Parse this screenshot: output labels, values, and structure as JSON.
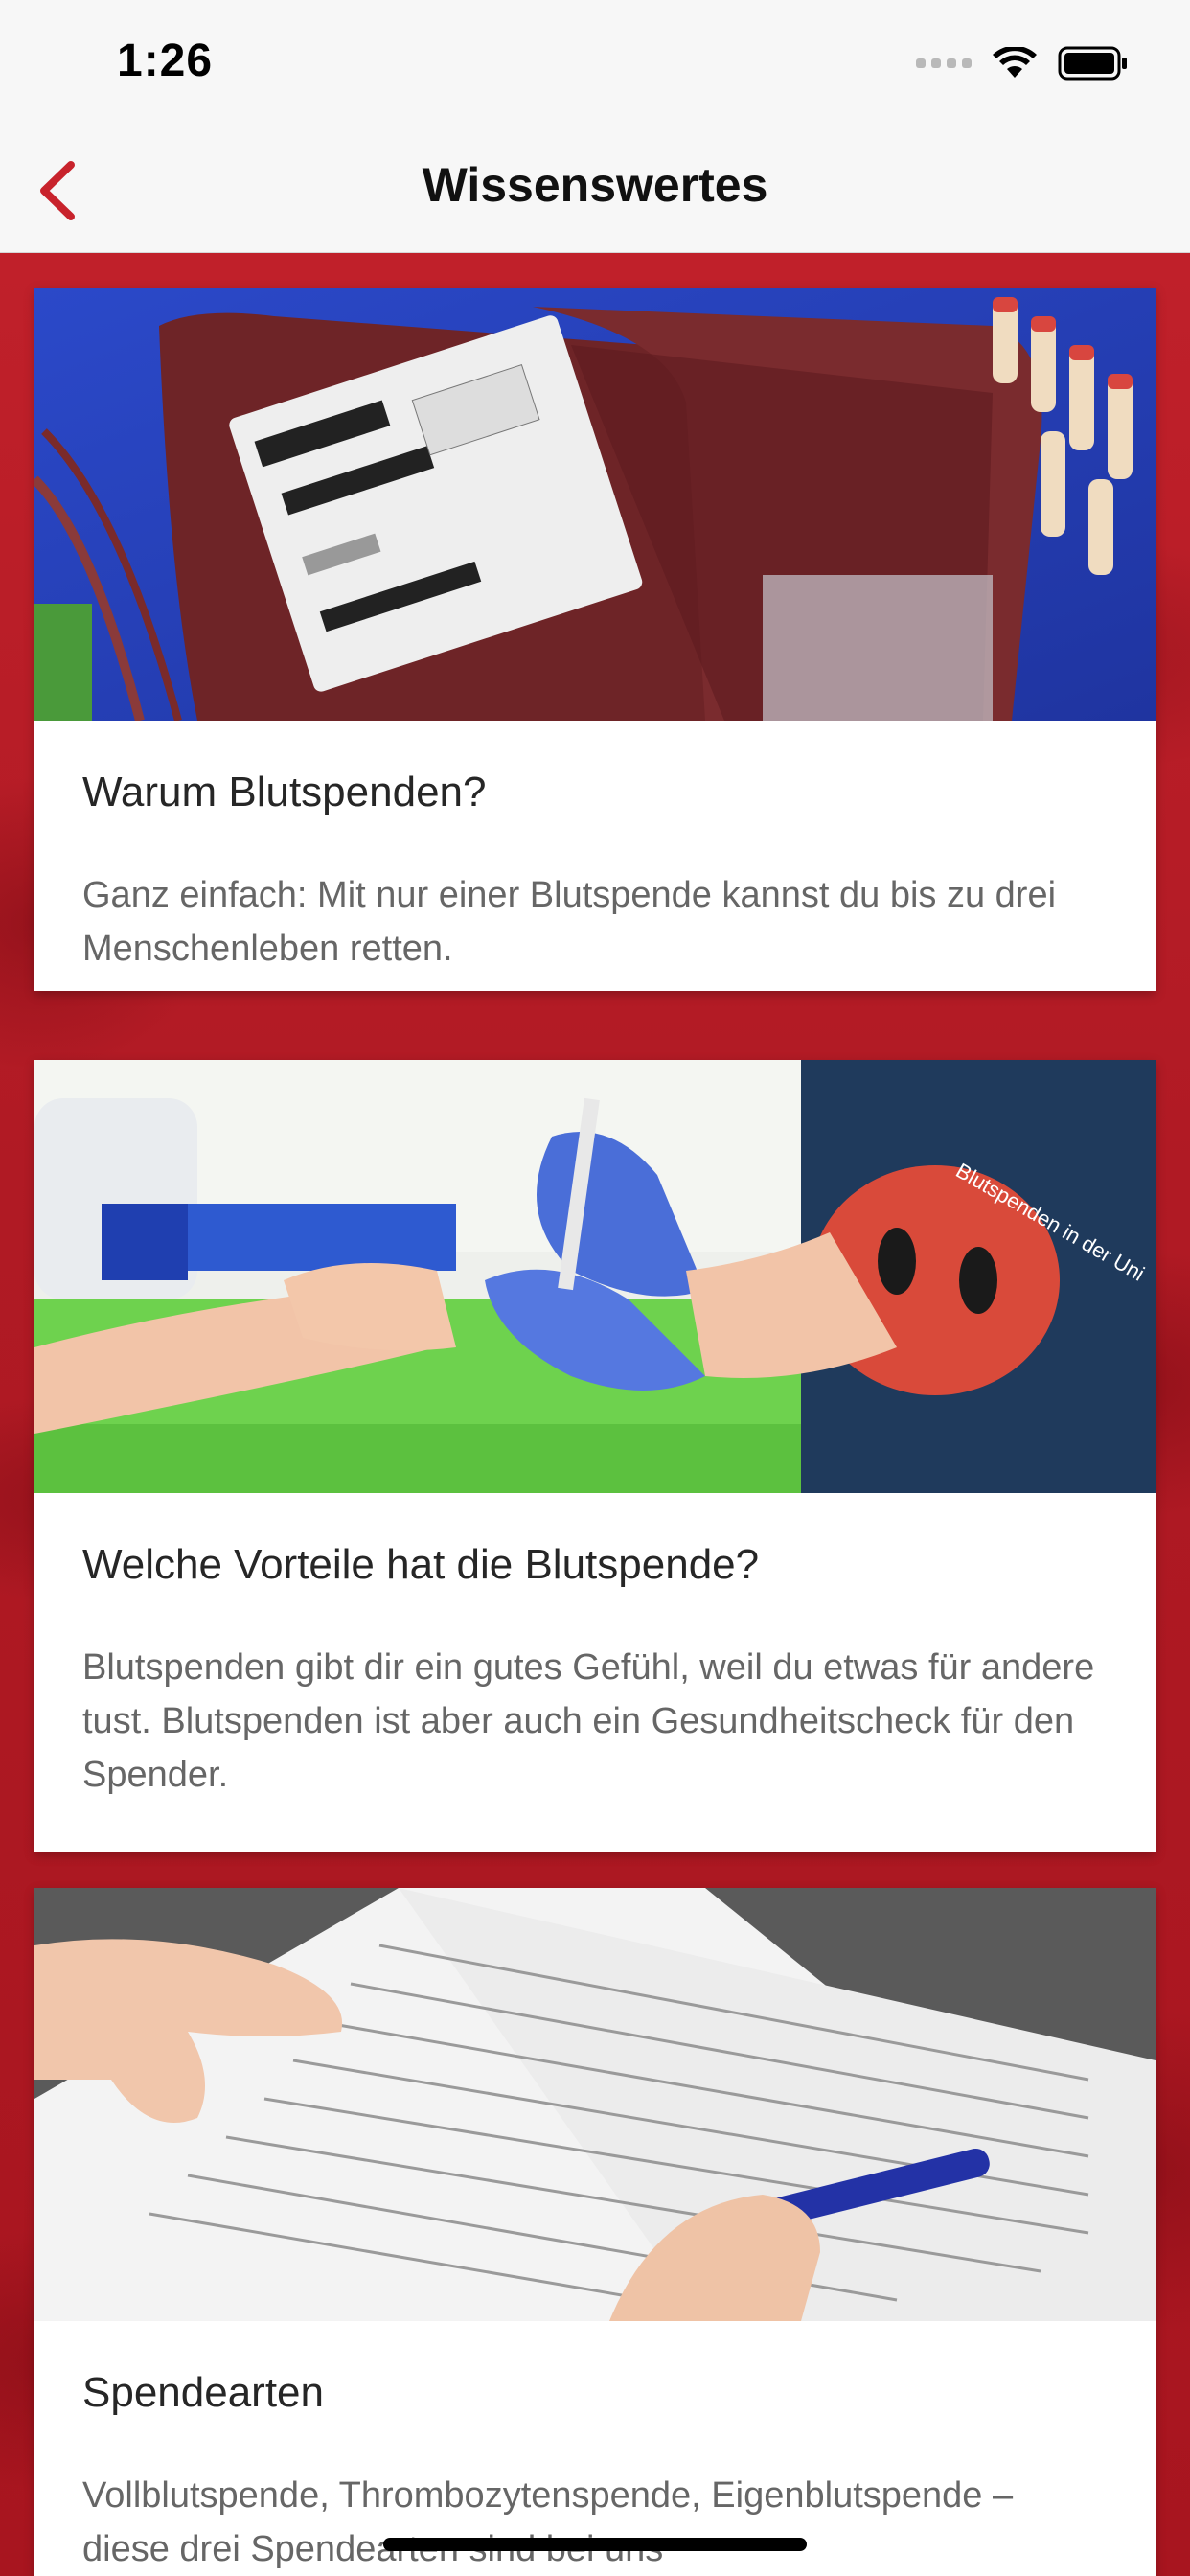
{
  "status_bar": {
    "time": "1:26"
  },
  "nav": {
    "title": "Wissenswertes",
    "back_label": "Zurück"
  },
  "colors": {
    "accent": "#c8232c",
    "background_red": "#b01a24"
  },
  "cards": [
    {
      "title": "Warum Blutspenden?",
      "text": "Ganz einfach: Mit nur einer Blutspende kannst du bis zu drei Menschenleben retten.",
      "image_description": "blood-bags-photo"
    },
    {
      "title": "Welche Vorteile hat die Blutspende?",
      "text": "Blutspenden gibt dir ein gutes Gefühl, weil du etwas für andere tust. Blutspenden ist aber auch ein Gesundheitscheck für den Spender.",
      "image_description": "finger-prick-test-photo",
      "shirt_text": "Blutspenden in der Uni"
    },
    {
      "title": "Spendearten",
      "text": "Vollblutspende, Thrombozytenspende, Eigenblutspende – diese drei Spendearten sind bei uns",
      "image_description": "questionnaire-photo"
    }
  ]
}
